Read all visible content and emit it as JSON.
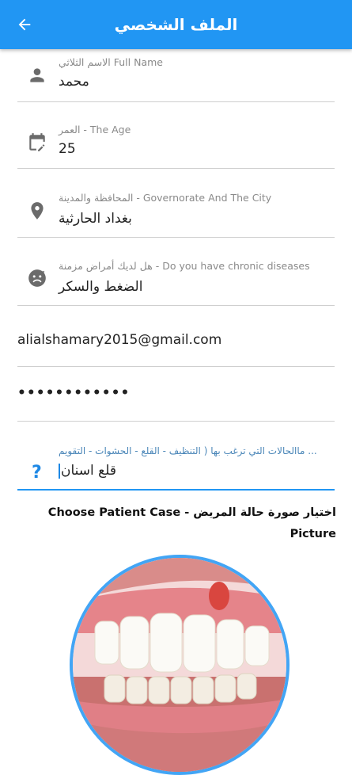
{
  "appbar": {
    "title": "الملف الشخصي",
    "back_icon": "arrow-back-icon"
  },
  "colors": {
    "primary": "#2196f3",
    "focus": "#1e88e5"
  },
  "form": {
    "full_name": {
      "label": "الاسم الثلاثي Full Name",
      "value": "محمد",
      "icon": "person-icon"
    },
    "age": {
      "label": "العمر - The Age",
      "value": "25",
      "icon": "calendar-edit-icon"
    },
    "city": {
      "label": "المحافظة والمدينة - Governorate And The City",
      "value": "بغداد الحارثية",
      "icon": "location-pin-icon"
    },
    "diseases": {
      "label": "هل لديك أمراض مزمنة - Do you have chronic diseases",
      "value": "الضغط والسكر",
      "icon": "sick-face-icon"
    },
    "email": {
      "value": "alialshamary2015@gmail.com"
    },
    "password": {
      "value": "••••••••••••"
    },
    "case": {
      "label": "ماالحالات التي ترغب بها ( التنظيف - القلع - الحشوات - التقويم ...",
      "value": "قلع اسنان",
      "icon": "help-question-icon"
    }
  },
  "picker": {
    "text": "Choose Patient Case - اختيار صورة حالة المريض Picture"
  }
}
